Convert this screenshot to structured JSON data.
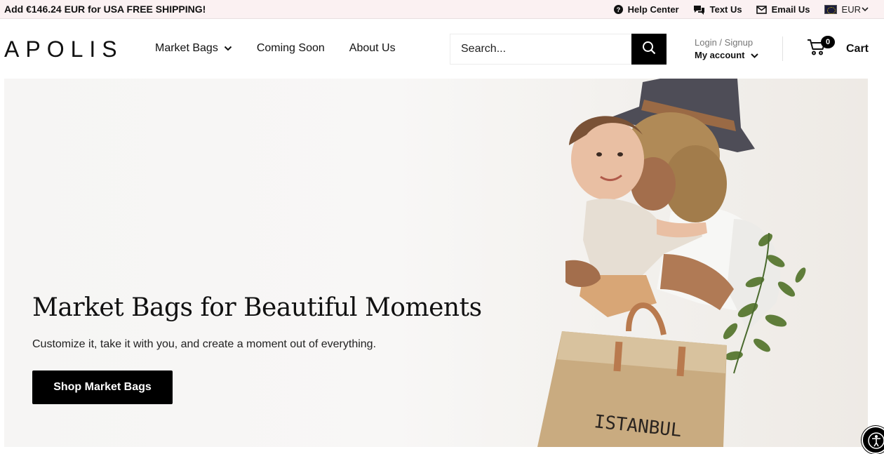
{
  "topbar": {
    "promo": "Add €146.24 EUR for USA FREE SHIPPING!",
    "help_center": "Help Center",
    "text_us": "Text Us",
    "email_us": "Email Us",
    "currency": "EUR"
  },
  "header": {
    "logo": "APOLIS",
    "nav": [
      {
        "label": "Market Bags",
        "has_dropdown": true
      },
      {
        "label": "Coming Soon",
        "has_dropdown": false
      },
      {
        "label": "About Us",
        "has_dropdown": false
      }
    ],
    "search": {
      "placeholder": "Search...",
      "value": ""
    },
    "account": {
      "login_signup": "Login / Signup",
      "my_account": "My account"
    },
    "cart": {
      "count": "0",
      "label": "Cart"
    }
  },
  "hero": {
    "title": "Market Bags for Beautiful Moments",
    "subtitle": "Customize it, take it with you, and create a moment out of everything.",
    "cta": "Shop Market Bags",
    "bag_print": "ISTANBUL"
  },
  "colors": {
    "accent": "#000000",
    "topbar_bg": "#fbf1f2"
  }
}
